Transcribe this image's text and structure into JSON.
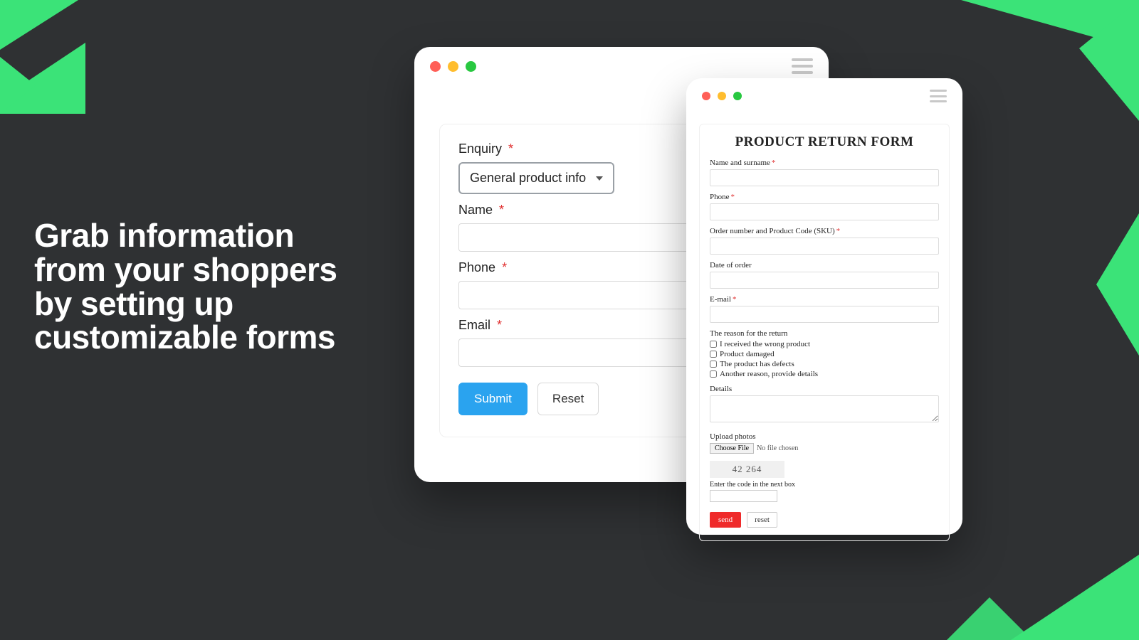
{
  "headline": "Grab information from your shoppers by setting up customizable forms",
  "form_a": {
    "enquiry_label": "Enquiry",
    "enquiry_value": "General product info",
    "name_label": "Name",
    "phone_label": "Phone",
    "email_label": "Email",
    "submit_label": "Submit",
    "reset_label": "Reset"
  },
  "form_b": {
    "title": "PRODUCT RETURN FORM",
    "name_label": "Name and surname",
    "phone_label": "Phone",
    "order_label": "Order number and Product Code (SKU)",
    "date_label": "Date of order",
    "email_label": "E-mail",
    "reason_label": "The reason for the return",
    "reasons": [
      "I received the wrong product",
      "Product damaged",
      "The product has defects",
      "Another reason, provide details"
    ],
    "details_label": "Details",
    "upload_label": "Upload photos",
    "choose_file_label": "Choose File",
    "no_file_text": "No file chosen",
    "captcha_code": "42 264",
    "captcha_label": "Enter the code in the next box",
    "send_label": "send",
    "reset_label": "reset"
  }
}
